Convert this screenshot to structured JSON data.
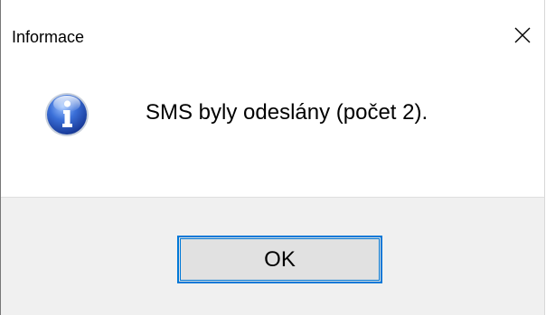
{
  "dialog": {
    "title": "Informace",
    "close_icon": "close-icon",
    "message_icon": "info-icon",
    "message": "SMS byly odeslány (počet 2).",
    "ok_label": "OK"
  },
  "colors": {
    "accent_border": "#0078d7",
    "footer_bg": "#f0f0f0",
    "button_bg": "#e1e1e1",
    "icon_blue": "#1f4fb8"
  }
}
